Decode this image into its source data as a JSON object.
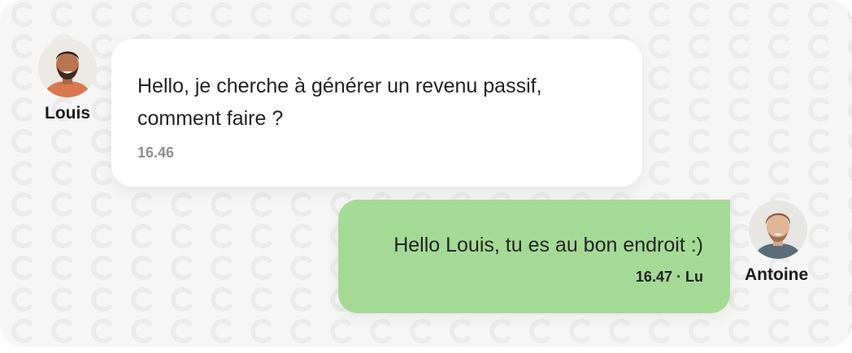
{
  "conversation": {
    "messages": [
      {
        "sender": "Louis",
        "text": "Hello, je cherche à générer un revenu passif, comment faire ?",
        "time": "16.46"
      },
      {
        "sender": "Antoine",
        "text": "Hello Louis, tu es au bon endroit :)",
        "time": "16.47",
        "separator": "·",
        "status": "Lu"
      }
    ]
  },
  "colors": {
    "background": "#f6f6f6",
    "pattern": "#ebebeb",
    "incoming_bubble": "#ffffff",
    "outgoing_bubble": "#a5da96",
    "timestamp_incoming": "#8f8f8f"
  },
  "icons": {
    "louis_avatar": "louis-avatar",
    "antoine_avatar": "antoine-avatar"
  }
}
